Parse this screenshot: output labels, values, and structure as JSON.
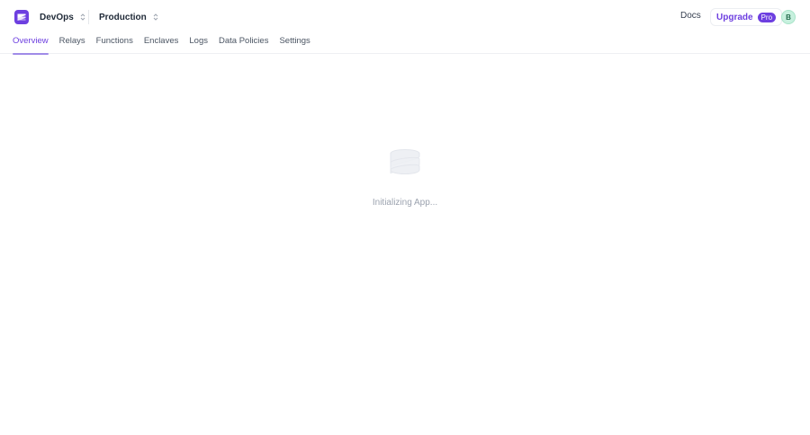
{
  "header": {
    "org_switcher": {
      "label": "DevOps",
      "icon": "chevron-up-down-icon"
    },
    "env_switcher": {
      "label": "Production",
      "icon": "chevron-up-down-icon"
    },
    "docs_label": "Docs",
    "upgrade": {
      "label": "Upgrade",
      "badge": "Pro"
    },
    "avatar_initial": "B"
  },
  "tabs": [
    {
      "label": "Overview",
      "active": true
    },
    {
      "label": "Relays",
      "active": false
    },
    {
      "label": "Functions",
      "active": false
    },
    {
      "label": "Enclaves",
      "active": false
    },
    {
      "label": "Logs",
      "active": false
    },
    {
      "label": "Data Policies",
      "active": false
    },
    {
      "label": "Settings",
      "active": false
    }
  ],
  "loading": {
    "icon": "app-logo-icon",
    "text": "Initializing App..."
  },
  "colors": {
    "brand": "#6d3fe0",
    "tab_underline": "#a08be8",
    "loader_text": "#9ca3af",
    "avatar_bg": "#c7f0de"
  }
}
